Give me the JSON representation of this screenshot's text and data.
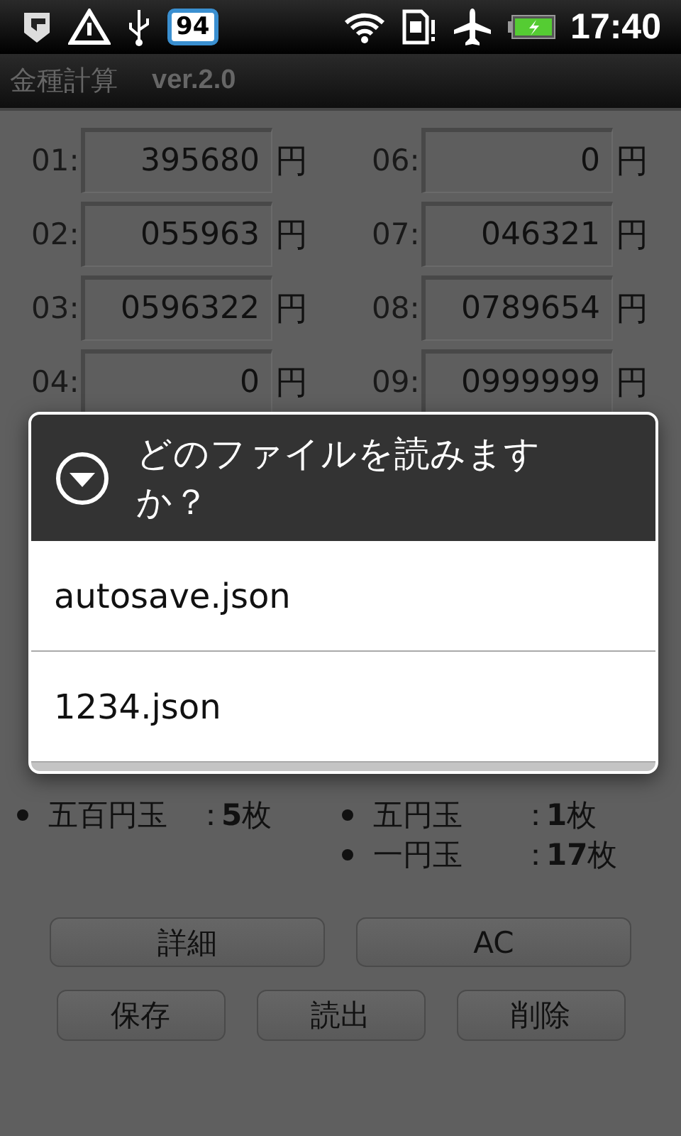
{
  "status_bar": {
    "battery_badge": "94",
    "time": "17:40"
  },
  "app_bar": {
    "title": "金種計算",
    "version": "ver.2.0"
  },
  "left_fields": [
    {
      "label": "01:",
      "value": "395680",
      "unit": "円"
    },
    {
      "label": "02:",
      "value": "055963",
      "unit": "円"
    },
    {
      "label": "03:",
      "value": "0596322",
      "unit": "円"
    },
    {
      "label": "04:",
      "value": "0",
      "unit": "円"
    }
  ],
  "right_fields": [
    {
      "label": "06:",
      "value": "0",
      "unit": "円"
    },
    {
      "label": "07:",
      "value": "046321",
      "unit": "円"
    },
    {
      "label": "08:",
      "value": "0789654",
      "unit": "円"
    },
    {
      "label": "09:",
      "value": "0999999",
      "unit": "円"
    }
  ],
  "left_counts": [
    {
      "name": "五百円玉",
      "sep": "：",
      "count": "5",
      "unit": "枚"
    }
  ],
  "right_counts": [
    {
      "name": "五円玉",
      "sep": "：",
      "count": "1",
      "unit": "枚"
    },
    {
      "name": "一円玉",
      "sep": "：",
      "count": "17",
      "unit": "枚"
    }
  ],
  "top_buttons": [
    "詳細",
    "AC"
  ],
  "bottom_buttons": [
    "保存",
    "読出",
    "削除"
  ],
  "dialog": {
    "title": "どのファイルを読みますか？",
    "items": [
      "autosave.json",
      "1234.json"
    ]
  }
}
